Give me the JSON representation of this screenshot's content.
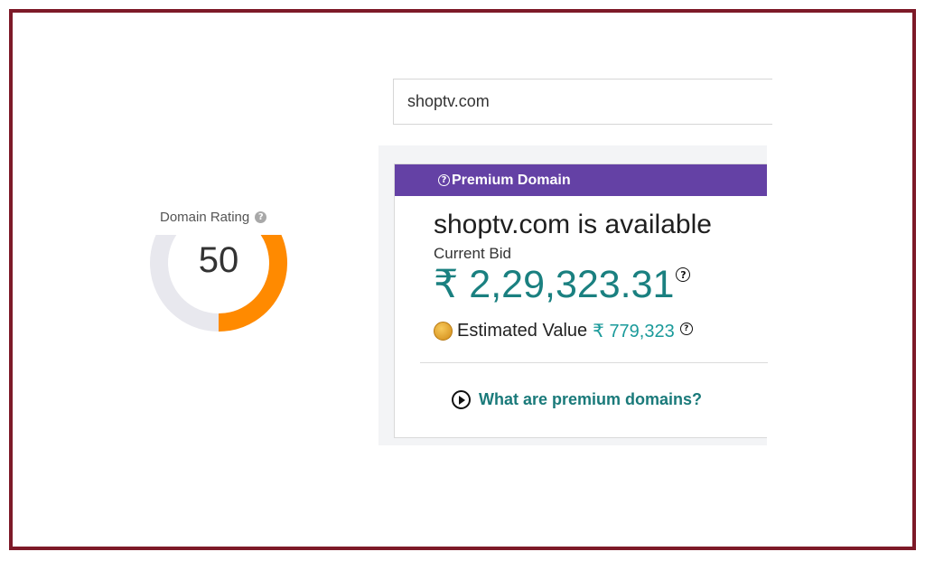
{
  "rating": {
    "label": "Domain Rating",
    "help_icon": "question-circle-icon",
    "help_glyph": "?",
    "value": "50",
    "score": 50,
    "max": 100,
    "colors": {
      "fill": "#ff8a00",
      "track": "#e8e8ee"
    }
  },
  "search": {
    "value": "shoptv.com"
  },
  "card": {
    "header_icon": "question-circle-icon",
    "header_glyph": "?",
    "header_label": "Premium Domain",
    "header_color": "#6441a5",
    "title": "shoptv.com is available",
    "bid_label": "Current Bid",
    "bid_value": "₹ 2,29,323.31",
    "bid_help_glyph": "?",
    "estimate_icon": "coin-icon",
    "estimate_label": "Estimated Value",
    "estimate_value": "₹ 779,323",
    "estimate_help_glyph": "?",
    "link_icon": "play-circle-icon",
    "link_label": "What are premium domains?",
    "accent_color": "#1a8080"
  }
}
